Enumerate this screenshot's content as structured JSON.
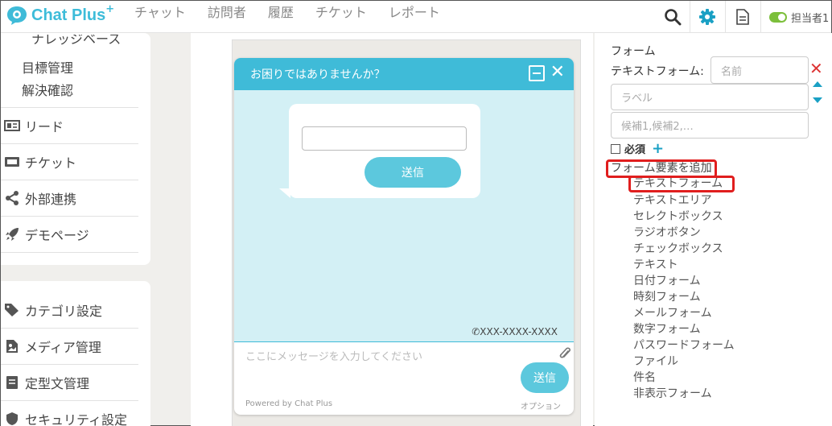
{
  "header": {
    "logo": "Chat Plus",
    "logo_plus": "+",
    "nav": [
      "チャット",
      "訪問者",
      "履歴",
      "チケット",
      "レポート"
    ],
    "status_label": "担当者1"
  },
  "sidebar": {
    "partial_item": "ナレッジベース",
    "sub_items": [
      "目標管理",
      "解決確認"
    ],
    "items": [
      {
        "label": "リード",
        "icon": "id-card-icon"
      },
      {
        "label": "チケット",
        "icon": "ticket-icon"
      },
      {
        "label": "外部連携",
        "icon": "share-icon"
      },
      {
        "label": "デモページ",
        "icon": "rocket-icon"
      }
    ],
    "items2": [
      {
        "label": "カテゴリ設定",
        "icon": "tag-icon"
      },
      {
        "label": "メディア管理",
        "icon": "media-icon"
      },
      {
        "label": "定型文管理",
        "icon": "book-icon"
      },
      {
        "label": "セキュリティ設定",
        "icon": "shield-icon"
      }
    ]
  },
  "widget": {
    "title": "お困りではありませんか？",
    "send_label": "送信",
    "phone": "XXX-XXXX-XXXX",
    "message_placeholder": "ここにメッセージを入力してください",
    "footer_send": "送信",
    "powered": "Powered by Chat Plus",
    "option": "オプション"
  },
  "form_panel": {
    "title": "フォーム",
    "text_form_label": "テキストフォーム:",
    "name_placeholder": "名前",
    "label_placeholder": "ラベル",
    "options_placeholder": "候補1,候補2,…",
    "required_label": "必須",
    "add_element_label": "フォーム要素を追加",
    "elements": [
      "テキストフォーム",
      "テキストエリア",
      "セレクトボックス",
      "ラジオボタン",
      "チェックボックス",
      "テキスト",
      "日付フォーム",
      "時刻フォーム",
      "メールフォーム",
      "数字フォーム",
      "パスワードフォーム",
      "ファイル",
      "件名",
      "非表示フォーム"
    ]
  },
  "colors": {
    "brand": "#3fbbd8",
    "highlight": "#e01e1e",
    "status_on": "#7cbf3b"
  }
}
